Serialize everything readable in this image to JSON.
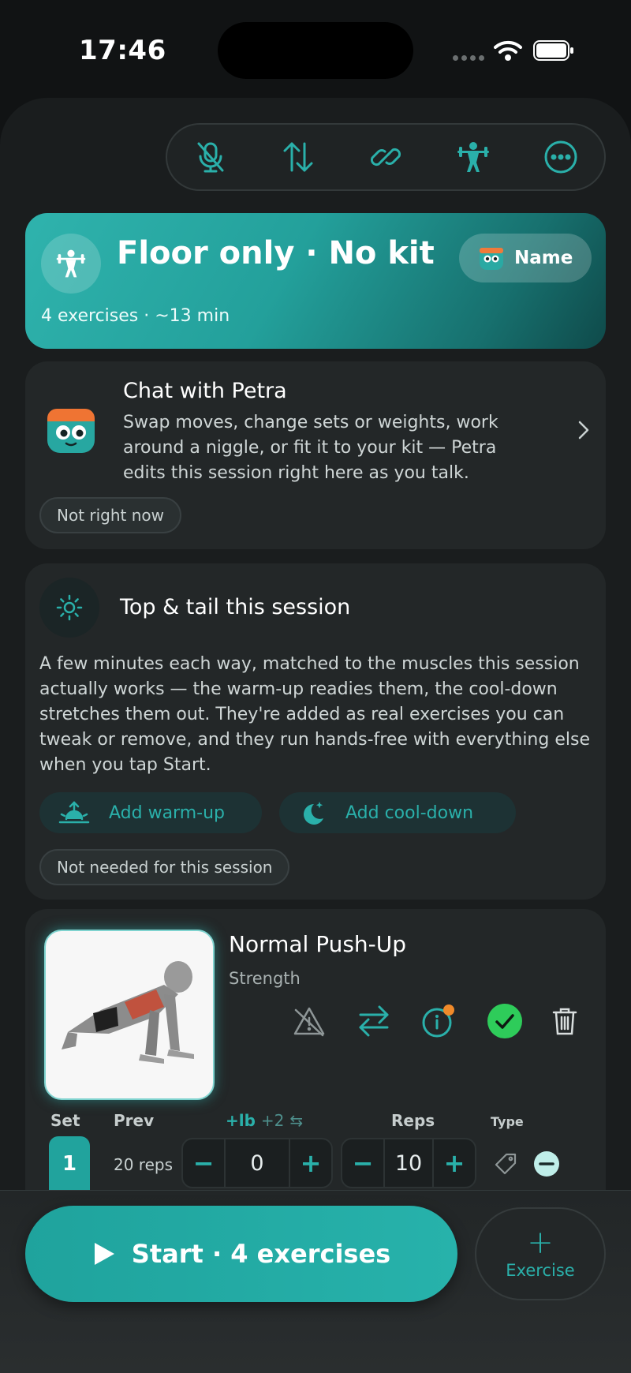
{
  "status_bar": {
    "time": "17:46"
  },
  "toolbar": {
    "icons": [
      "microphone-off-icon",
      "reorder-icon",
      "link-icon",
      "weightlifter-icon",
      "more-icon"
    ]
  },
  "header": {
    "title": "Floor only · No kit",
    "subtitle": "4 exercises · ~13 min",
    "name_button": "Name"
  },
  "chat": {
    "title": "Chat with Petra",
    "body": "Swap moves, change sets or weights, work around a niggle, or fit it to your kit — Petra edits this session right here as you talk.",
    "dismiss": "Not right now"
  },
  "top_tail": {
    "title": "Top & tail this session",
    "body": "A few minutes each way, matched to the muscles this session actually works — the warm-up readies them, the cool-down stretches them out. They're added as real exercises you can tweak or remove, and they run hands-free with everything else when you tap Start.",
    "warmup": "Add warm-up",
    "cooldown": "Add cool-down",
    "dismiss": "Not needed for this session"
  },
  "exercise": {
    "name": "Normal Push-Up",
    "category": "Strength",
    "columns": {
      "set": "Set",
      "prev": "Prev",
      "weight": "+lb",
      "weight_extra": "+2",
      "reps": "Reps",
      "type": "Type"
    },
    "sets": [
      {
        "number": "1",
        "prev": "20 reps",
        "weight": "0",
        "reps": "10"
      }
    ]
  },
  "bottom": {
    "start": "Start · 4 exercises",
    "add_plus": "+",
    "add_label": "Exercise"
  },
  "colors": {
    "accent": "#2ab0aa",
    "background": "#1a1d1e",
    "card": "#232728",
    "done_green": "#2ecc5a"
  }
}
